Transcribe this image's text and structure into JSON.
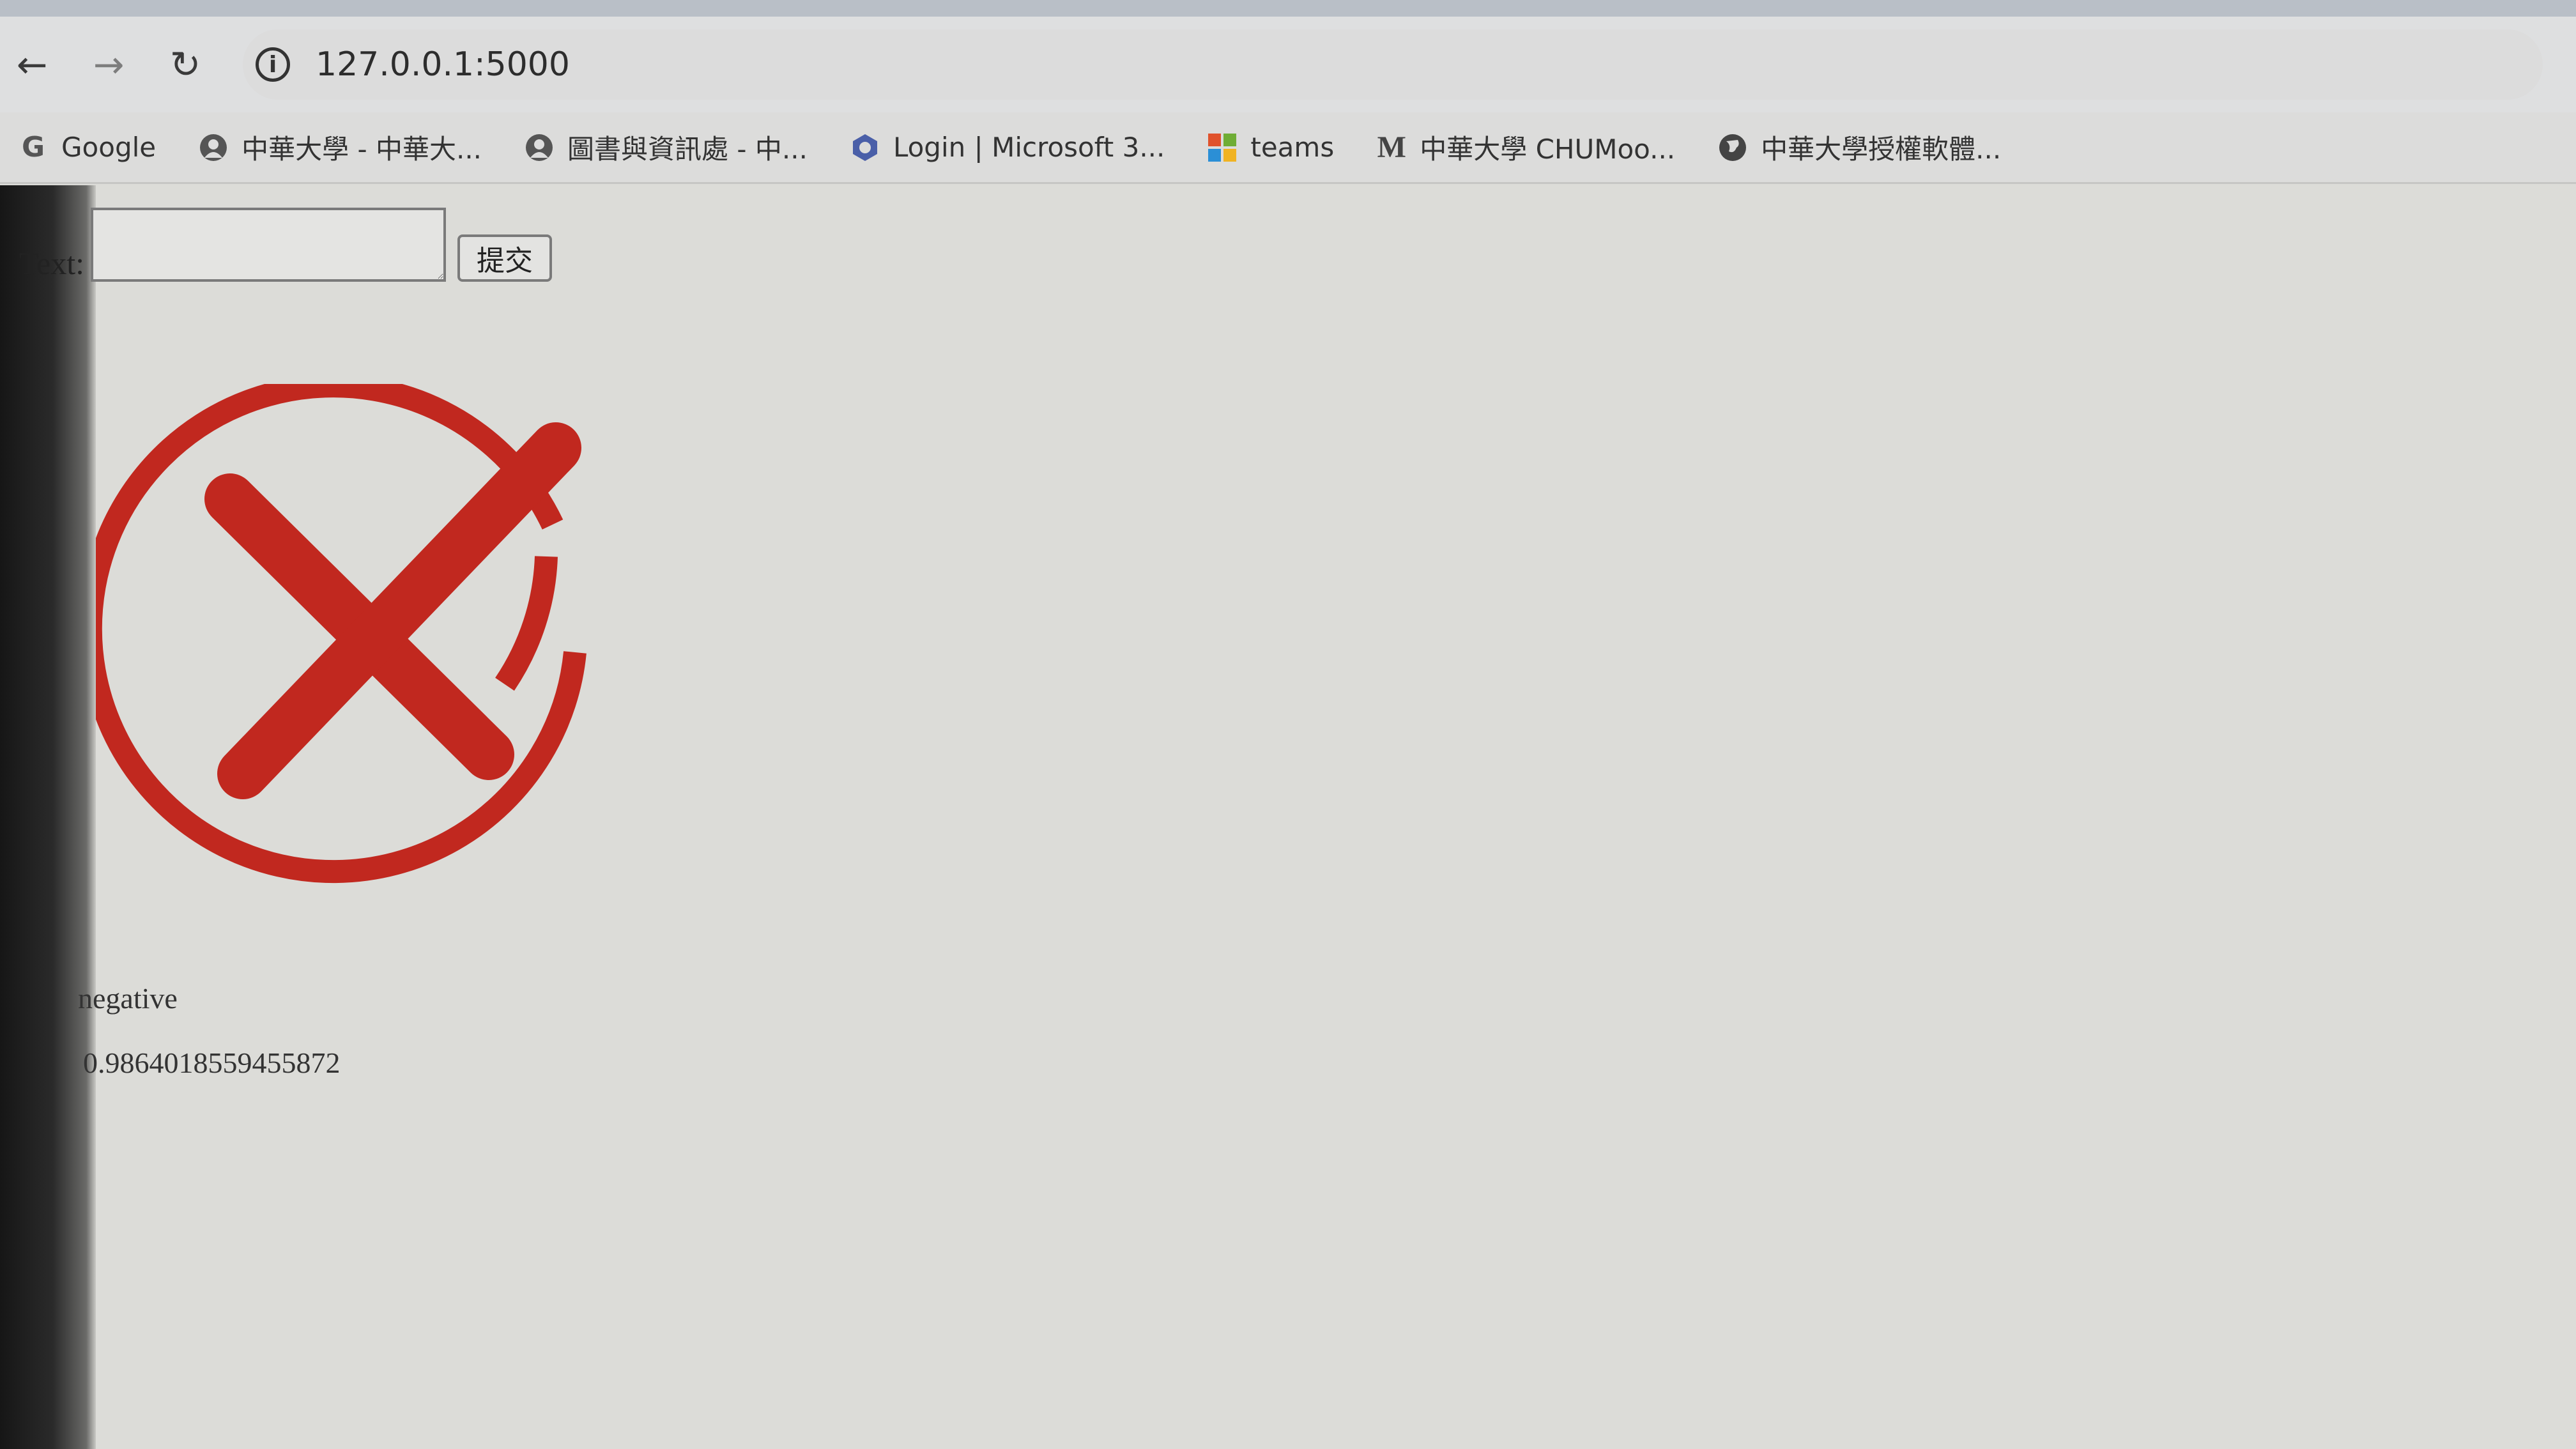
{
  "browser": {
    "url": "127.0.0.1:5000",
    "bookmarks": [
      {
        "label": "Google",
        "icon": "google-icon"
      },
      {
        "label": "中華大學 - 中華大...",
        "icon": "chu-logo-icon"
      },
      {
        "label": "圖書與資訊處 - 中...",
        "icon": "chu-logo-icon"
      },
      {
        "label": "Login | Microsoft 3...",
        "icon": "office-icon"
      },
      {
        "label": "teams",
        "icon": "microsoft-icon"
      },
      {
        "label": "中華大學 CHUMoo...",
        "icon": "moodle-icon"
      },
      {
        "label": "中華大學授權軟體...",
        "icon": "globe-icon"
      }
    ]
  },
  "form": {
    "label": "Text:",
    "input_value": "",
    "submit_label": "提交"
  },
  "result": {
    "icon": "red-x-circle-icon",
    "label": "negative",
    "score": "0.9864018559455872"
  },
  "colors": {
    "mark_red": "#c1281f",
    "page_bg": "#dcdcd8"
  }
}
